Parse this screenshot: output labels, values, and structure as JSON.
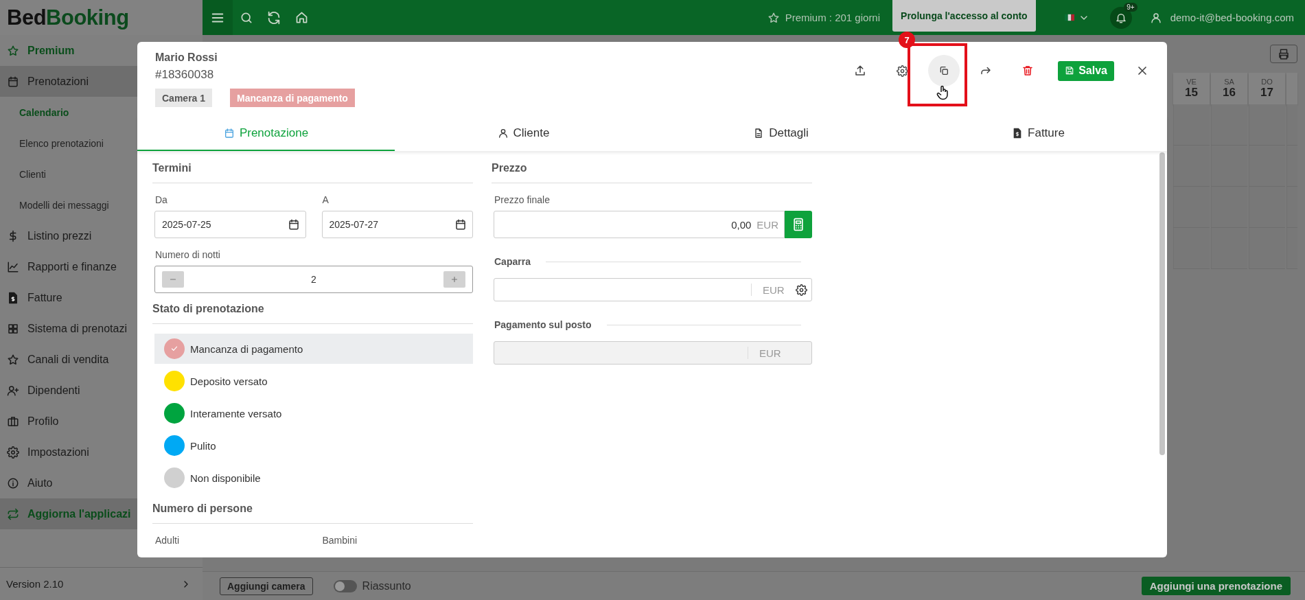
{
  "topbar": {
    "logo": {
      "first": "Bed",
      "second": "Booking"
    },
    "premium": "Premium : 201 giorni",
    "extend_button": "Prolunga l'accesso al conto",
    "notifications_badge": "9+",
    "user": "demo-it@bed-booking.com"
  },
  "sidebar": {
    "items": [
      {
        "label": "Premium",
        "kind": "premium"
      },
      {
        "label": "Prenotazioni",
        "kind": "group",
        "expanded": true,
        "children": [
          {
            "label": "Calendario",
            "selected": true
          },
          {
            "label": "Elenco prenotazioni",
            "selected": false
          },
          {
            "label": "Clienti",
            "selected": false
          },
          {
            "label": "Modelli dei messaggi",
            "selected": false
          }
        ]
      },
      {
        "label": "Listino prezzi",
        "kind": "link"
      },
      {
        "label": "Rapporti e finanze",
        "kind": "link"
      },
      {
        "label": "Fatture",
        "kind": "link"
      },
      {
        "label": "Sistema di prenotazi",
        "kind": "link"
      },
      {
        "label": "Canali di vendita",
        "kind": "link"
      },
      {
        "label": "Dipendenti",
        "kind": "link"
      },
      {
        "label": "Profilo",
        "kind": "link"
      },
      {
        "label": "Impostazioni",
        "kind": "link"
      },
      {
        "label": "Aiuto",
        "kind": "link"
      },
      {
        "label": "Aggiorna l'applicazi",
        "kind": "update"
      }
    ],
    "version": "Version 2.10"
  },
  "calendar": {
    "days": [
      {
        "weekday": "VE",
        "day": "15"
      },
      {
        "weekday": "SA",
        "day": "16"
      },
      {
        "weekday": "DO",
        "day": "17"
      }
    ]
  },
  "bottom_bar": {
    "add_room": "Aggiungi camera",
    "summary_toggle": {
      "label": "Riassunto",
      "on": false
    },
    "add_booking": "Aggiungi una prenotazione"
  },
  "modal": {
    "guest_name": "Mario Rossi",
    "booking_id": "#18360038",
    "room_chip": "Camera 1",
    "status_chip": "Mancanza di pagamento",
    "save_button": "Salva",
    "step_badge": "7",
    "tabs": [
      {
        "label": "Prenotazione",
        "selected": true
      },
      {
        "label": "Cliente",
        "selected": false
      },
      {
        "label": "Dettagli",
        "selected": false
      },
      {
        "label": "Fatture",
        "selected": false
      }
    ],
    "terms": {
      "title": "Termini",
      "from_label": "Da",
      "from_value": "2025-07-25",
      "to_label": "A",
      "to_value": "2025-07-27",
      "nights_label": "Numero di notti",
      "nights_value": "2"
    },
    "status": {
      "title": "Stato di prenotazione",
      "options": [
        {
          "label": "Mancanza di pagamento",
          "color": "#e6a0a0",
          "selected": true
        },
        {
          "label": "Deposito versato",
          "color": "#ffe100",
          "selected": false
        },
        {
          "label": "Interamente versato",
          "color": "#00a43f",
          "selected": false
        },
        {
          "label": "Pulito",
          "color": "#00a9f4",
          "selected": false
        },
        {
          "label": "Non disponibile",
          "color": "#d0d0d0",
          "selected": false
        }
      ]
    },
    "persons": {
      "title": "Numero di persone",
      "adults_label": "Adulti",
      "children_label": "Bambini"
    },
    "price": {
      "title": "Prezzo",
      "final_label": "Prezzo finale",
      "final_value": "0,00",
      "final_currency": "EUR",
      "deposit_label": "Caparra",
      "deposit_currency": "EUR",
      "onsite_label": "Pagamento sul posto",
      "onsite_currency": "EUR"
    }
  }
}
